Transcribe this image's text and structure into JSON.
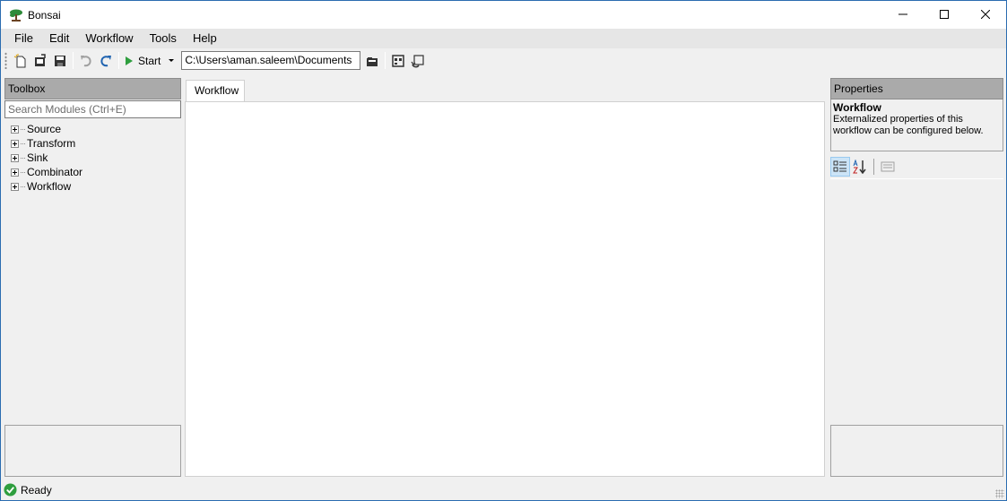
{
  "window": {
    "title": "Bonsai"
  },
  "menu": {
    "items": [
      "File",
      "Edit",
      "Workflow",
      "Tools",
      "Help"
    ]
  },
  "toolbar": {
    "start_label": "Start",
    "path_value": "C:\\Users\\aman.saleem\\Documents"
  },
  "toolbox": {
    "header": "Toolbox",
    "search_placeholder": "Search Modules (Ctrl+E)",
    "items": [
      "Source",
      "Transform",
      "Sink",
      "Combinator",
      "Workflow"
    ]
  },
  "editor": {
    "tab_label": "Workflow"
  },
  "properties": {
    "header": "Properties",
    "title": "Workflow",
    "description": "Externalized properties of this workflow can be configured below."
  },
  "status": {
    "text": "Ready"
  },
  "colors": {
    "accent_green": "#2e9e3e",
    "redo_blue": "#1f63b0",
    "panel_header": "#aaaaaa"
  }
}
